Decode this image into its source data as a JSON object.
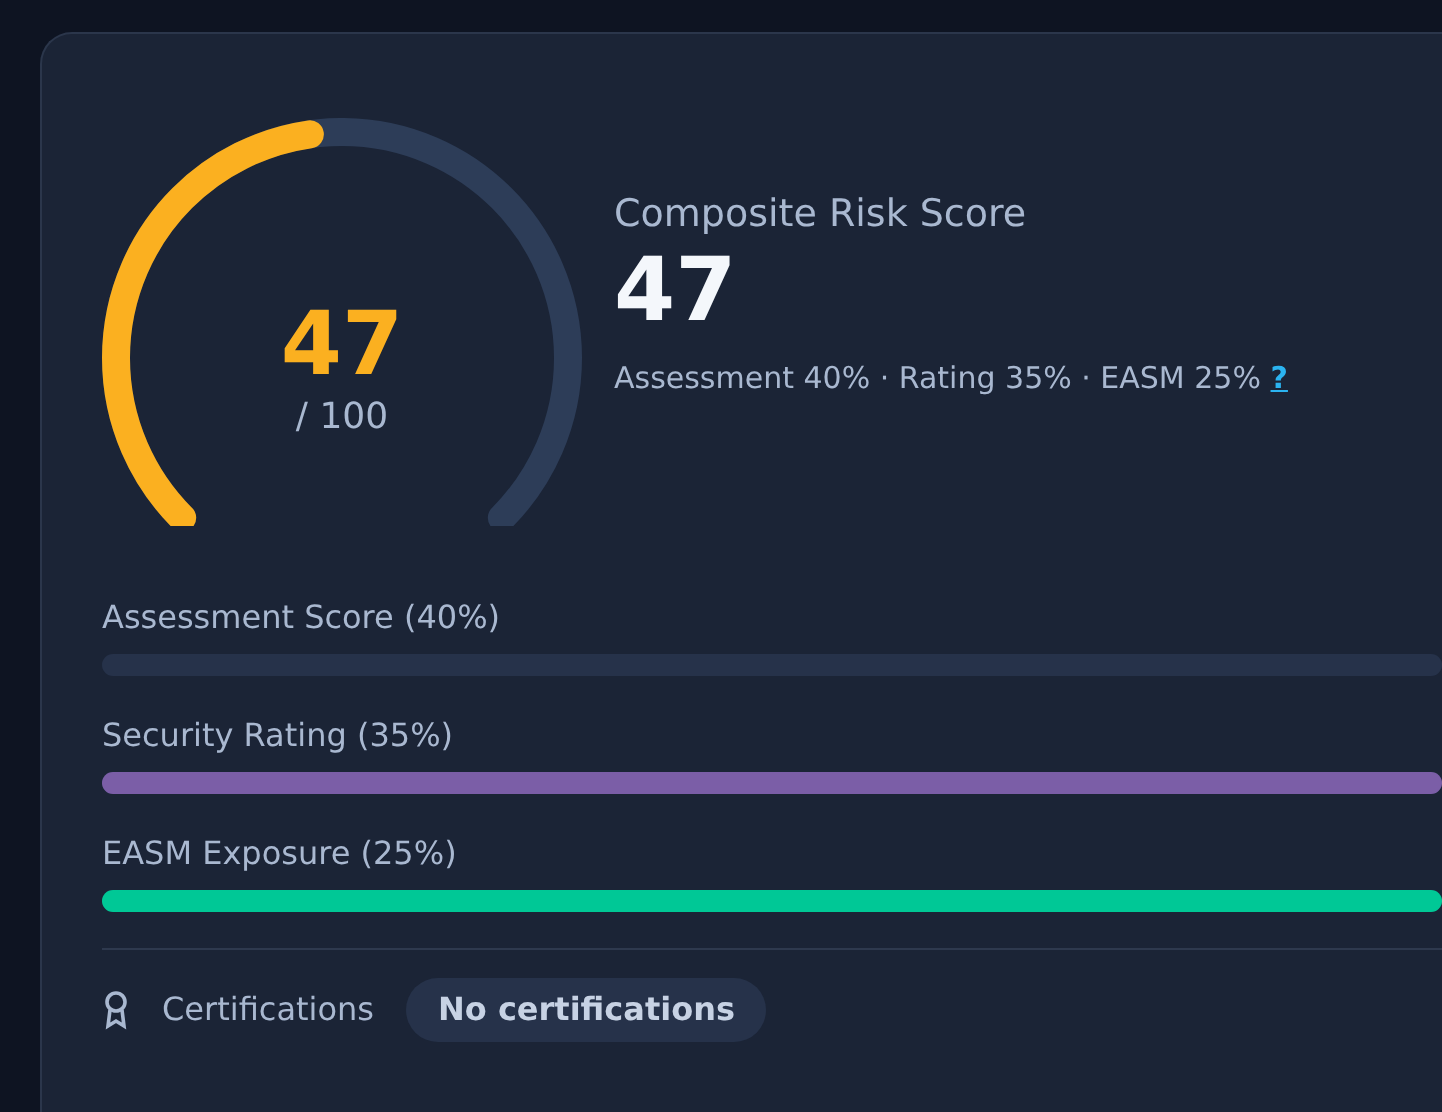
{
  "gauge": {
    "score": "47",
    "max": "/ 100"
  },
  "summary": {
    "title": "Composite Risk Score",
    "score": "47",
    "weights": "Assessment 40% · Rating 35% · EASM 25%",
    "help": "?"
  },
  "components": [
    {
      "label": "Assessment Score (40%)"
    },
    {
      "label": "Security Rating (35%)",
      "level": 1,
      "color": "#7b5ea7"
    },
    {
      "label": "EASM Exposure (25%)",
      "level": 1,
      "color": "#00c896"
    }
  ],
  "certifications": {
    "label": "Certifications",
    "value": "No certifications"
  }
}
